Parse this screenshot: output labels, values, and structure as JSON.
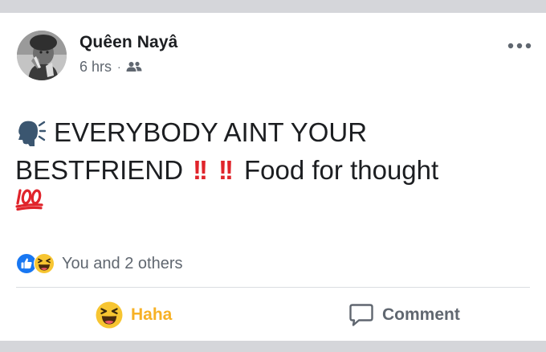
{
  "post": {
    "author_name": "Quêen Nayâ",
    "timestamp": "6 hrs",
    "separator": "·",
    "audience_icon": "friends-icon",
    "more_icon": "more-options-icon",
    "text": {
      "line1": "EVERYBODY AINT YOUR",
      "line2_start": "BESTFRIEND",
      "line2_bang1": "!!",
      "line2_bang2": "!!",
      "line2_end": "Food for thought",
      "leading_emoji": "speaking-head-icon",
      "trailing_emoji": "hundred-points-icon"
    }
  },
  "reactions": {
    "types": [
      "like",
      "haha"
    ],
    "summary": "You and 2 others"
  },
  "actions": {
    "haha_label": "Haha",
    "comment_label": "Comment"
  },
  "colors": {
    "haha_yellow": "#f7b125",
    "like_blue": "#1877f2",
    "text_primary": "#1c1e21",
    "text_secondary": "#606770",
    "bang_red": "#e0242b",
    "band_gray": "#d5d6da"
  }
}
